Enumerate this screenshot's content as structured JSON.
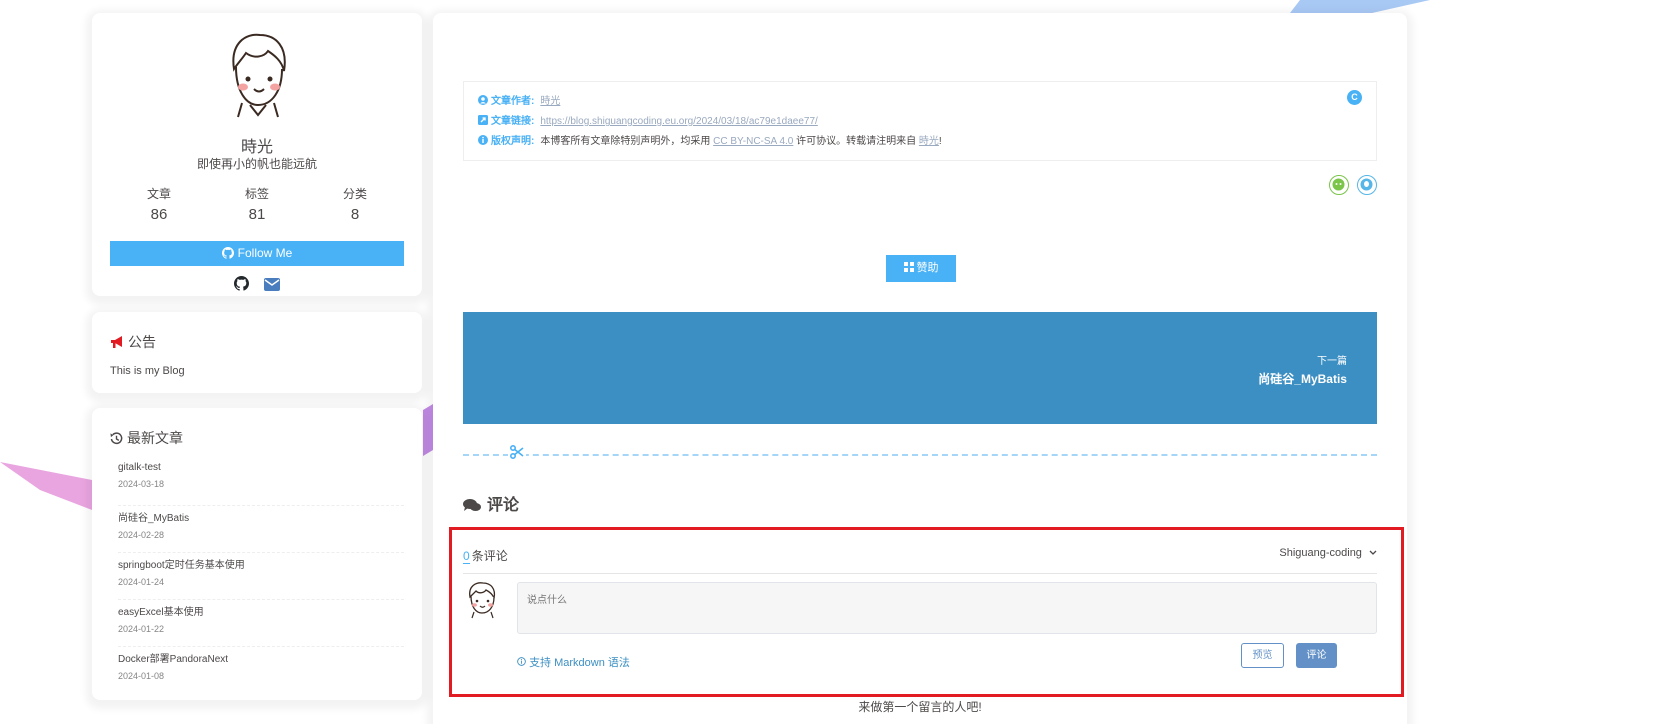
{
  "colors": {
    "accent": "#49b1f5",
    "next_bg": "#3b8fc3",
    "button_blue": "#6391c7",
    "highlight": "#e21b23",
    "red_icon": "#e21b23"
  },
  "author": {
    "name": "時光",
    "description": "即使再小的帆也能远航",
    "stats": [
      {
        "label": "文章",
        "value": "86"
      },
      {
        "label": "标签",
        "value": "81"
      },
      {
        "label": "分类",
        "value": "8"
      }
    ],
    "follow_label": "Follow Me",
    "social_icons": [
      "github-icon",
      "email-icon"
    ]
  },
  "announcement": {
    "title": "公告",
    "text": "This is my Blog",
    "icon": "bullhorn-icon"
  },
  "recent": {
    "title": "最新文章",
    "icon": "history-icon",
    "items": [
      {
        "title": "gitalk-test",
        "date": "2024-03-18"
      },
      {
        "title": "尚硅谷_MyBatis",
        "date": "2024-02-28"
      },
      {
        "title": "springboot定时任务基本使用",
        "date": "2024-01-24"
      },
      {
        "title": "easyExcel基本使用",
        "date": "2024-01-22"
      },
      {
        "title": "Docker部署PandoraNext",
        "date": "2024-01-08"
      }
    ]
  },
  "copyright": {
    "author_key": "文章作者:",
    "author_value": "時光",
    "link_key": "文章链接:",
    "link_value": "https://blog.shiguangcoding.eu.org/2024/03/18/ac79e1daee77/",
    "license_key": "版权声明:",
    "license_prefix": "本博客所有文章除特别声明外，均采用",
    "license_link": "CC BY-NC-SA 4.0",
    "license_middle": "许可协议。转载请注明来自",
    "license_author": "時光",
    "license_suffix": "!",
    "badge": "C"
  },
  "reward_label": "赞助",
  "next_post": {
    "label": "下一篇",
    "title": "尚硅谷_MyBatis"
  },
  "comments": {
    "heading": "评论",
    "count": "0",
    "count_suffix": "条评论",
    "user": "Shiguang-coding",
    "placeholder": "说点什么",
    "markdown_hint": "支持 Markdown 语法",
    "preview_label": "预览",
    "submit_label": "评论",
    "empty_tip": "来做第一个留言的人吧!"
  }
}
